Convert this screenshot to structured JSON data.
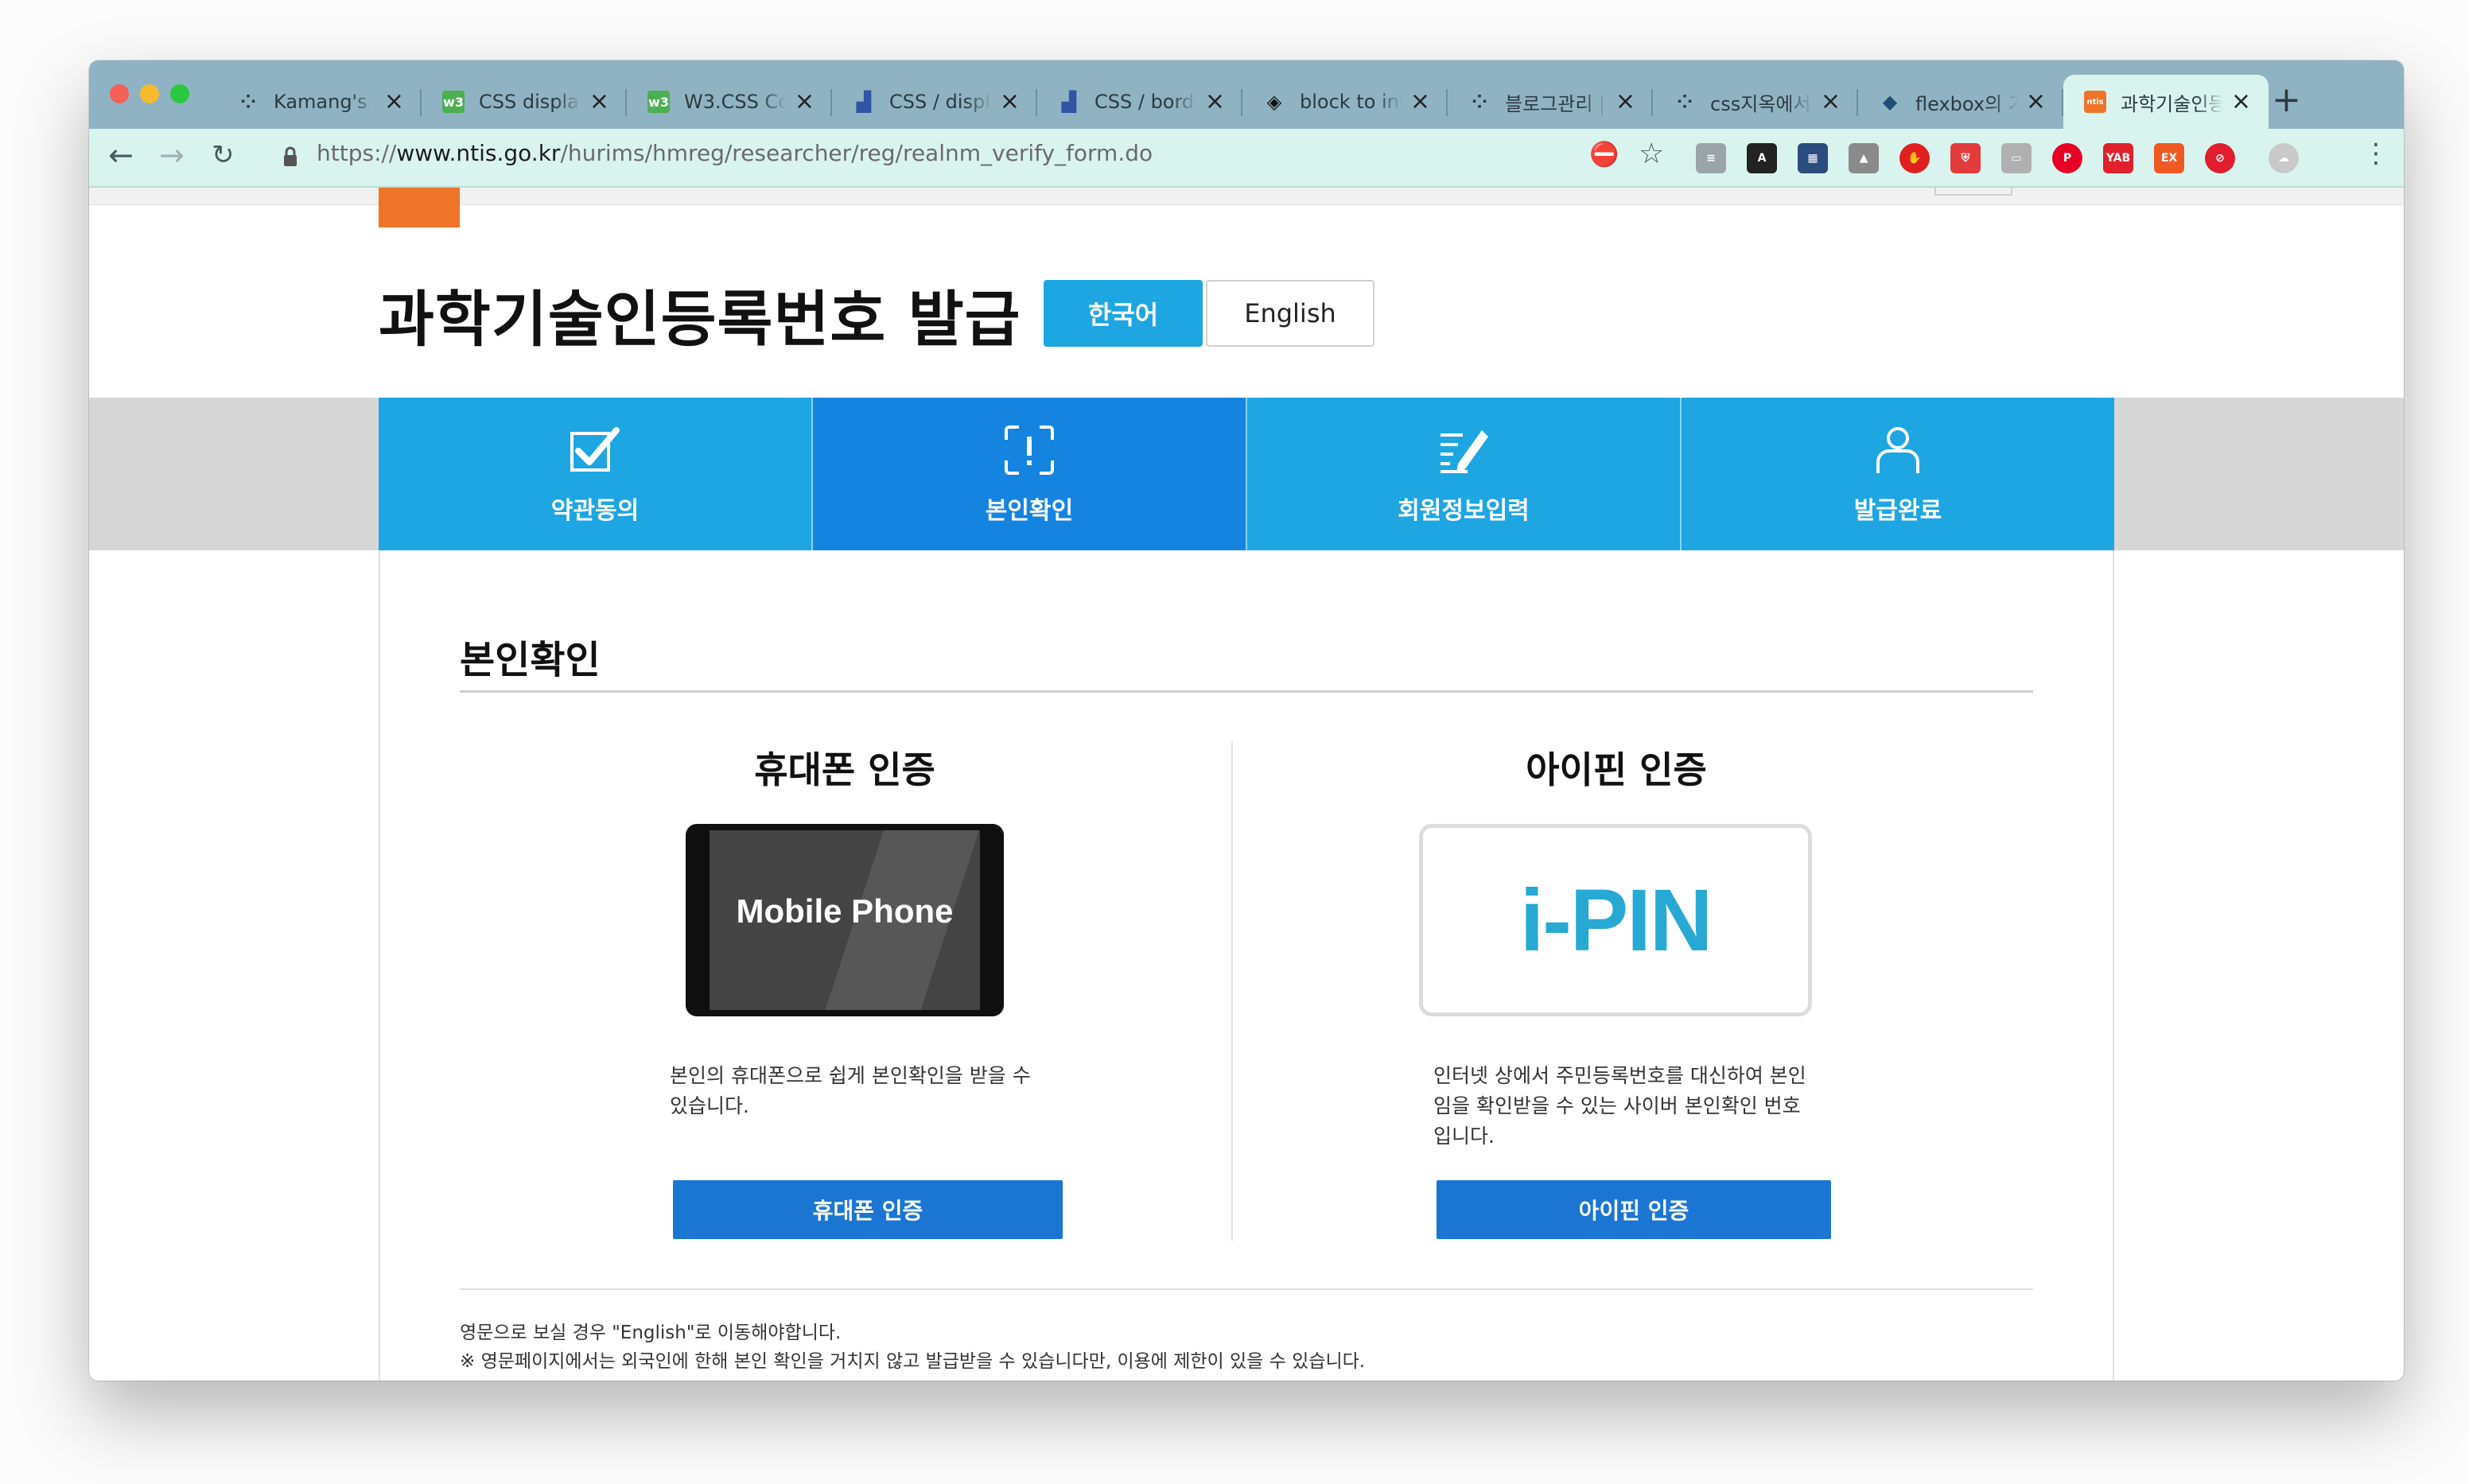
{
  "browser": {
    "tabs": [
      {
        "title": "Kamang's I",
        "favicon": "tistory-icon",
        "fav_color": "#2d3a40",
        "fav_text": "⁘"
      },
      {
        "title": "CSS display",
        "favicon": "w3schools-icon",
        "fav_color": "#4caf50",
        "fav_text": "w3"
      },
      {
        "title": "W3.CSS Co",
        "favicon": "w3schools-icon",
        "fav_color": "#4caf50",
        "fav_text": "w3"
      },
      {
        "title": "CSS / displ",
        "favicon": "bar-chart-icon",
        "fav_color": "#2f55a4",
        "fav_text": "▟"
      },
      {
        "title": "CSS / borde",
        "favicon": "bar-chart-icon",
        "fav_color": "#2f55a4",
        "fav_text": "▟"
      },
      {
        "title": "block to inl",
        "favicon": "codepen-icon",
        "fav_color": "#111111",
        "fav_text": "◈"
      },
      {
        "title": "블로그관리 |",
        "favicon": "tistory-icon",
        "fav_color": "#2d3a40",
        "fav_text": "⁘"
      },
      {
        "title": "css지옥에서",
        "favicon": "tistory-icon",
        "fav_color": "#2d3a40",
        "fav_text": "⁘"
      },
      {
        "title": "flexbox의 기",
        "favicon": "bird-icon",
        "fav_color": "#1a4f7a",
        "fav_text": "◆"
      },
      {
        "title": "과학기술인등",
        "favicon": "ntis-icon",
        "fav_color": "#ee7429",
        "fav_text": "ntis",
        "active": true
      }
    ],
    "new_tab": "+",
    "url_scheme": "https://",
    "url_domain": "www.ntis.go.kr",
    "url_path": "/hurims/hmreg/researcher/reg/realnm_verify_form.do",
    "extensions": [
      {
        "name": "ext-icon",
        "color": "#9aa5aa",
        "text": "≡"
      },
      {
        "name": "a-icon",
        "color": "#222222",
        "text": "A"
      },
      {
        "name": "ext-icon",
        "color": "#2b4c7e",
        "text": "▦"
      },
      {
        "name": "drive-icon",
        "color": "#8a8a8a",
        "text": "▲"
      },
      {
        "name": "stop-icon",
        "color": "#e02020",
        "text": "✋"
      },
      {
        "name": "shield-icon",
        "color": "#e23b3b",
        "text": "⛨"
      },
      {
        "name": "ext-icon",
        "color": "#b0b0b0",
        "text": "▭"
      },
      {
        "name": "pinterest-icon",
        "color": "#e60023",
        "text": "P"
      },
      {
        "name": "yab-icon",
        "color": "#e0202a",
        "text": "YAB"
      },
      {
        "name": "ex-icon",
        "color": "#ef5a23",
        "text": "EX"
      },
      {
        "name": "block-icon",
        "color": "#e01e2e",
        "text": "⊘"
      },
      {
        "name": "profile-icon",
        "color": "#c9c9c9",
        "text": "☁"
      }
    ]
  },
  "page": {
    "title": "과학기술인등록번호 발급",
    "lang_ko": "한국어",
    "lang_en": "English",
    "steps": [
      {
        "label": "약관동의",
        "icon": "checkbox-icon"
      },
      {
        "label": "본인확인",
        "icon": "scan-icon",
        "active": true
      },
      {
        "label": "회원정보입력",
        "icon": "edit-icon"
      },
      {
        "label": "발급완료",
        "icon": "user-icon"
      }
    ],
    "section_title": "본인확인",
    "phone": {
      "title": "휴대폰 인증",
      "image_text": "Mobile Phone",
      "desc_line1": "본인의 휴대폰으로 쉽게 본인확인을 받을 수",
      "desc_line2": "있습니다.",
      "button": "휴대폰 인증"
    },
    "ipin": {
      "title": "아이핀 인증",
      "image_text": "i-PIN",
      "desc_line1": "인터넷 상에서 주민등록번호를 대신하여 본인",
      "desc_line2": "임을 확인받을 수 있는 사이버 본인확인 번호",
      "desc_line3": "입니다.",
      "button": "아이핀 인증"
    },
    "note1": "영문으로 보실 경우 \"English\"로 이동해야합니다.",
    "note2": "※ 영문페이지에서는 외국인에 한해 본인 확인을 거치지 않고 발급받을 수 있습니다만, 이용에 제한이 있을 수 있습니다."
  }
}
